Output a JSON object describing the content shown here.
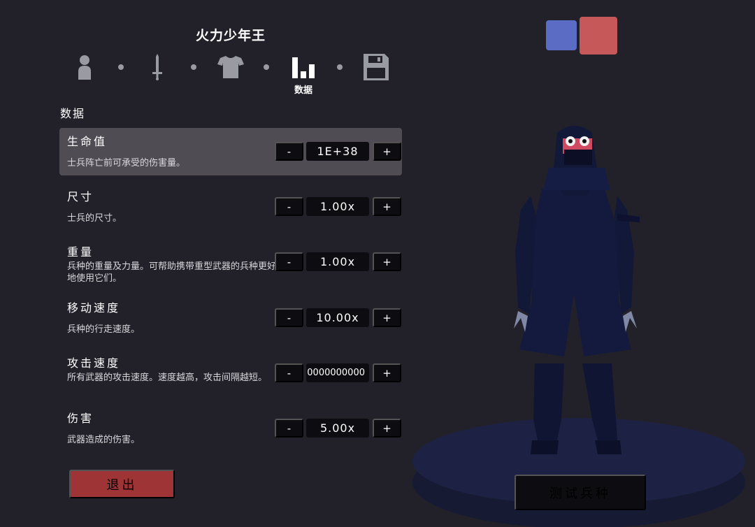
{
  "header": {
    "unit_name": "火力少年王",
    "nav": [
      {
        "icon": "person-icon",
        "active": false
      },
      {
        "icon": "sword-icon",
        "active": false
      },
      {
        "icon": "shirt-icon",
        "active": false
      },
      {
        "icon": "stats-icon",
        "active": true,
        "label": "数据"
      },
      {
        "icon": "save-icon",
        "active": false
      }
    ]
  },
  "section": {
    "title": "数据"
  },
  "stats": [
    {
      "name": "生命值",
      "desc": "士兵阵亡前可承受的伤害量。",
      "value": "1E+38",
      "selected": true
    },
    {
      "name": "尺寸",
      "desc": "士兵的尺寸。",
      "value": "1.00x",
      "selected": false
    },
    {
      "name": "重量",
      "desc": "兵种的重量及力量。可帮助携带重型武器的兵种更好地使用它们。",
      "value": "1.00x",
      "selected": false
    },
    {
      "name": "移动速度",
      "desc": "兵种的行走速度。",
      "value": "10.00x",
      "selected": false
    },
    {
      "name": "攻击速度",
      "desc": "所有武器的攻击速度。速度越高，攻击间隔越短。",
      "value": "0000000000",
      "selected": false
    },
    {
      "name": "伤害",
      "desc": "武器造成的伤害。",
      "value": "5.00x",
      "selected": false
    }
  ],
  "controls": {
    "minus": "-",
    "plus": "+"
  },
  "footer": {
    "exit_label": "退出",
    "test_label": "测试兵种"
  },
  "colors": {
    "background": "#22212a",
    "selected_row": "#4f4d53",
    "exit": "#9e3436",
    "team_blue": "#5a6cc4",
    "team_red": "#c6585a",
    "unit_body": "#141a3e",
    "platform": "#1d2244"
  }
}
